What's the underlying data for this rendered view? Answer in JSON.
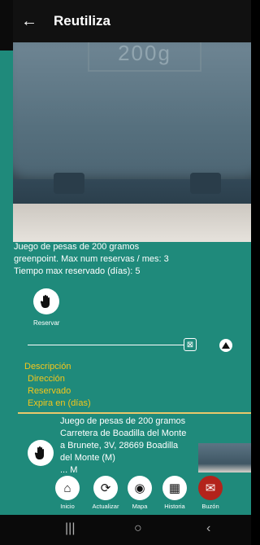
{
  "app_bar": {
    "title": "Reutiliza",
    "back_icon": "arrow-left-icon"
  },
  "photo": {
    "emboss_text": "200g"
  },
  "details": {
    "caption": "Juego de pesas de 200 gramos",
    "line1": "greenpoint. Max num reservas / mes: 3",
    "line2": "Tiempo max reservado (días): 5"
  },
  "reserve": {
    "label": "Reservar",
    "icon": "hand-icon"
  },
  "fields": {
    "descripcion": "Descripción",
    "direccion": "Dirección",
    "reservado": "Reservado",
    "expira": "Expira en (días)"
  },
  "item": {
    "line1": "Juego de pesas de 200 gramos",
    "line2": "Carretera de Boadilla del Monte",
    "line3": "a Brunete, 3V, 28669 Boadilla",
    "line4": "del Monte (M)",
    "line5": "... M"
  },
  "nav": {
    "inicio": "Inicio",
    "actualizar": "Actualizar",
    "mapa": "Mapa",
    "historia": "Historia",
    "buzon": "Buzón"
  },
  "colors": {
    "accent": "#1f8a7b",
    "label": "#f4c61b",
    "mailbox": "#b3231b"
  }
}
